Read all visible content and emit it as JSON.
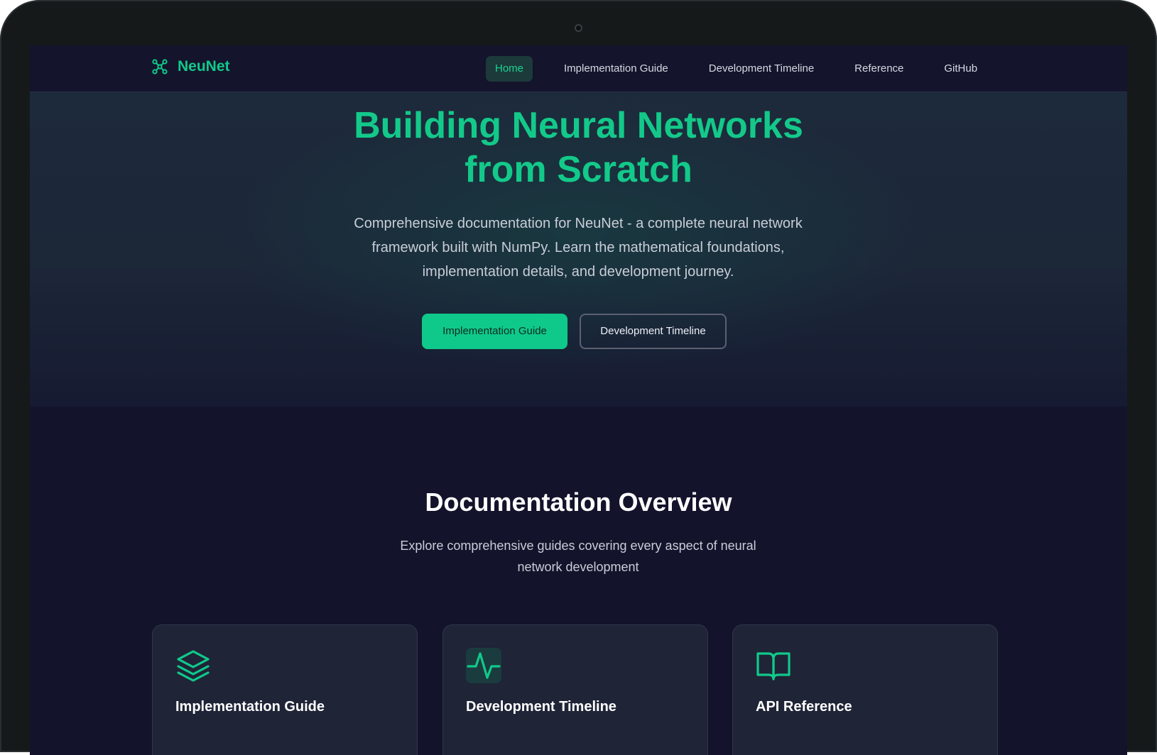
{
  "brand": {
    "name": "NeuNet",
    "icon": "network-icon",
    "accent": "#10c98a"
  },
  "nav": {
    "items": [
      {
        "label": "Home",
        "active": true
      },
      {
        "label": "Implementation Guide",
        "active": false
      },
      {
        "label": "Development Timeline",
        "active": false
      },
      {
        "label": "Reference",
        "active": false
      },
      {
        "label": "GitHub",
        "active": false
      }
    ]
  },
  "hero": {
    "title_line1": "Building Neural Networks",
    "title_line2": "from Scratch",
    "description_line1": "Comprehensive documentation for NeuNet - a complete neural network",
    "description_line2": "framework built with NumPy. Learn the mathematical foundations,",
    "description_line3": "implementation details, and development journey.",
    "primary_button": "Implementation Guide",
    "secondary_button": "Development Timeline"
  },
  "overview": {
    "title": "Documentation Overview",
    "subtitle_line1": "Explore comprehensive guides covering every aspect of neural",
    "subtitle_line2": "network development",
    "cards": [
      {
        "title": "Implementation Guide",
        "icon": "layers-icon"
      },
      {
        "title": "Development Timeline",
        "icon": "activity-icon"
      },
      {
        "title": "API Reference",
        "icon": "book-open-icon"
      }
    ]
  },
  "colors": {
    "accent": "#10c98a",
    "background": "#13132b",
    "card": "#1f2437"
  }
}
